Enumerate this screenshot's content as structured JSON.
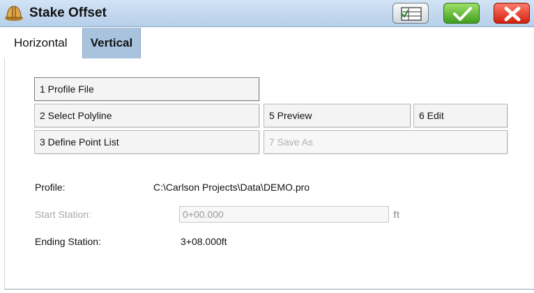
{
  "window": {
    "title": "Stake Offset"
  },
  "tabs": [
    {
      "label": "Horizontal",
      "active": false
    },
    {
      "label": "Vertical",
      "active": true
    }
  ],
  "buttons": {
    "profile_file": "1 Profile File",
    "select_polyline": "2 Select Polyline",
    "define_point_list": "3 Define Point List",
    "preview": "5 Preview",
    "edit": "6 Edit",
    "save_as": "7 Save As"
  },
  "fields": {
    "profile_label": "Profile:",
    "profile_value": "C:\\Carlson Projects\\Data\\DEMO.pro",
    "start_station_label": "Start Station:",
    "start_station_value": "0+00.000",
    "start_station_unit": "ft",
    "ending_station_label": "Ending Station:",
    "ending_station_value": "3+08.000ft"
  },
  "icons": {
    "app": "hard-hat-icon",
    "list": "list-check-icon",
    "ok": "checkmark-icon",
    "cancel": "close-x-icon"
  },
  "colors": {
    "titlebar": "#b6cfea",
    "active_tab": "#a9c3de",
    "ok_button": "#3f9e1d",
    "cancel_button": "#d2200e"
  }
}
